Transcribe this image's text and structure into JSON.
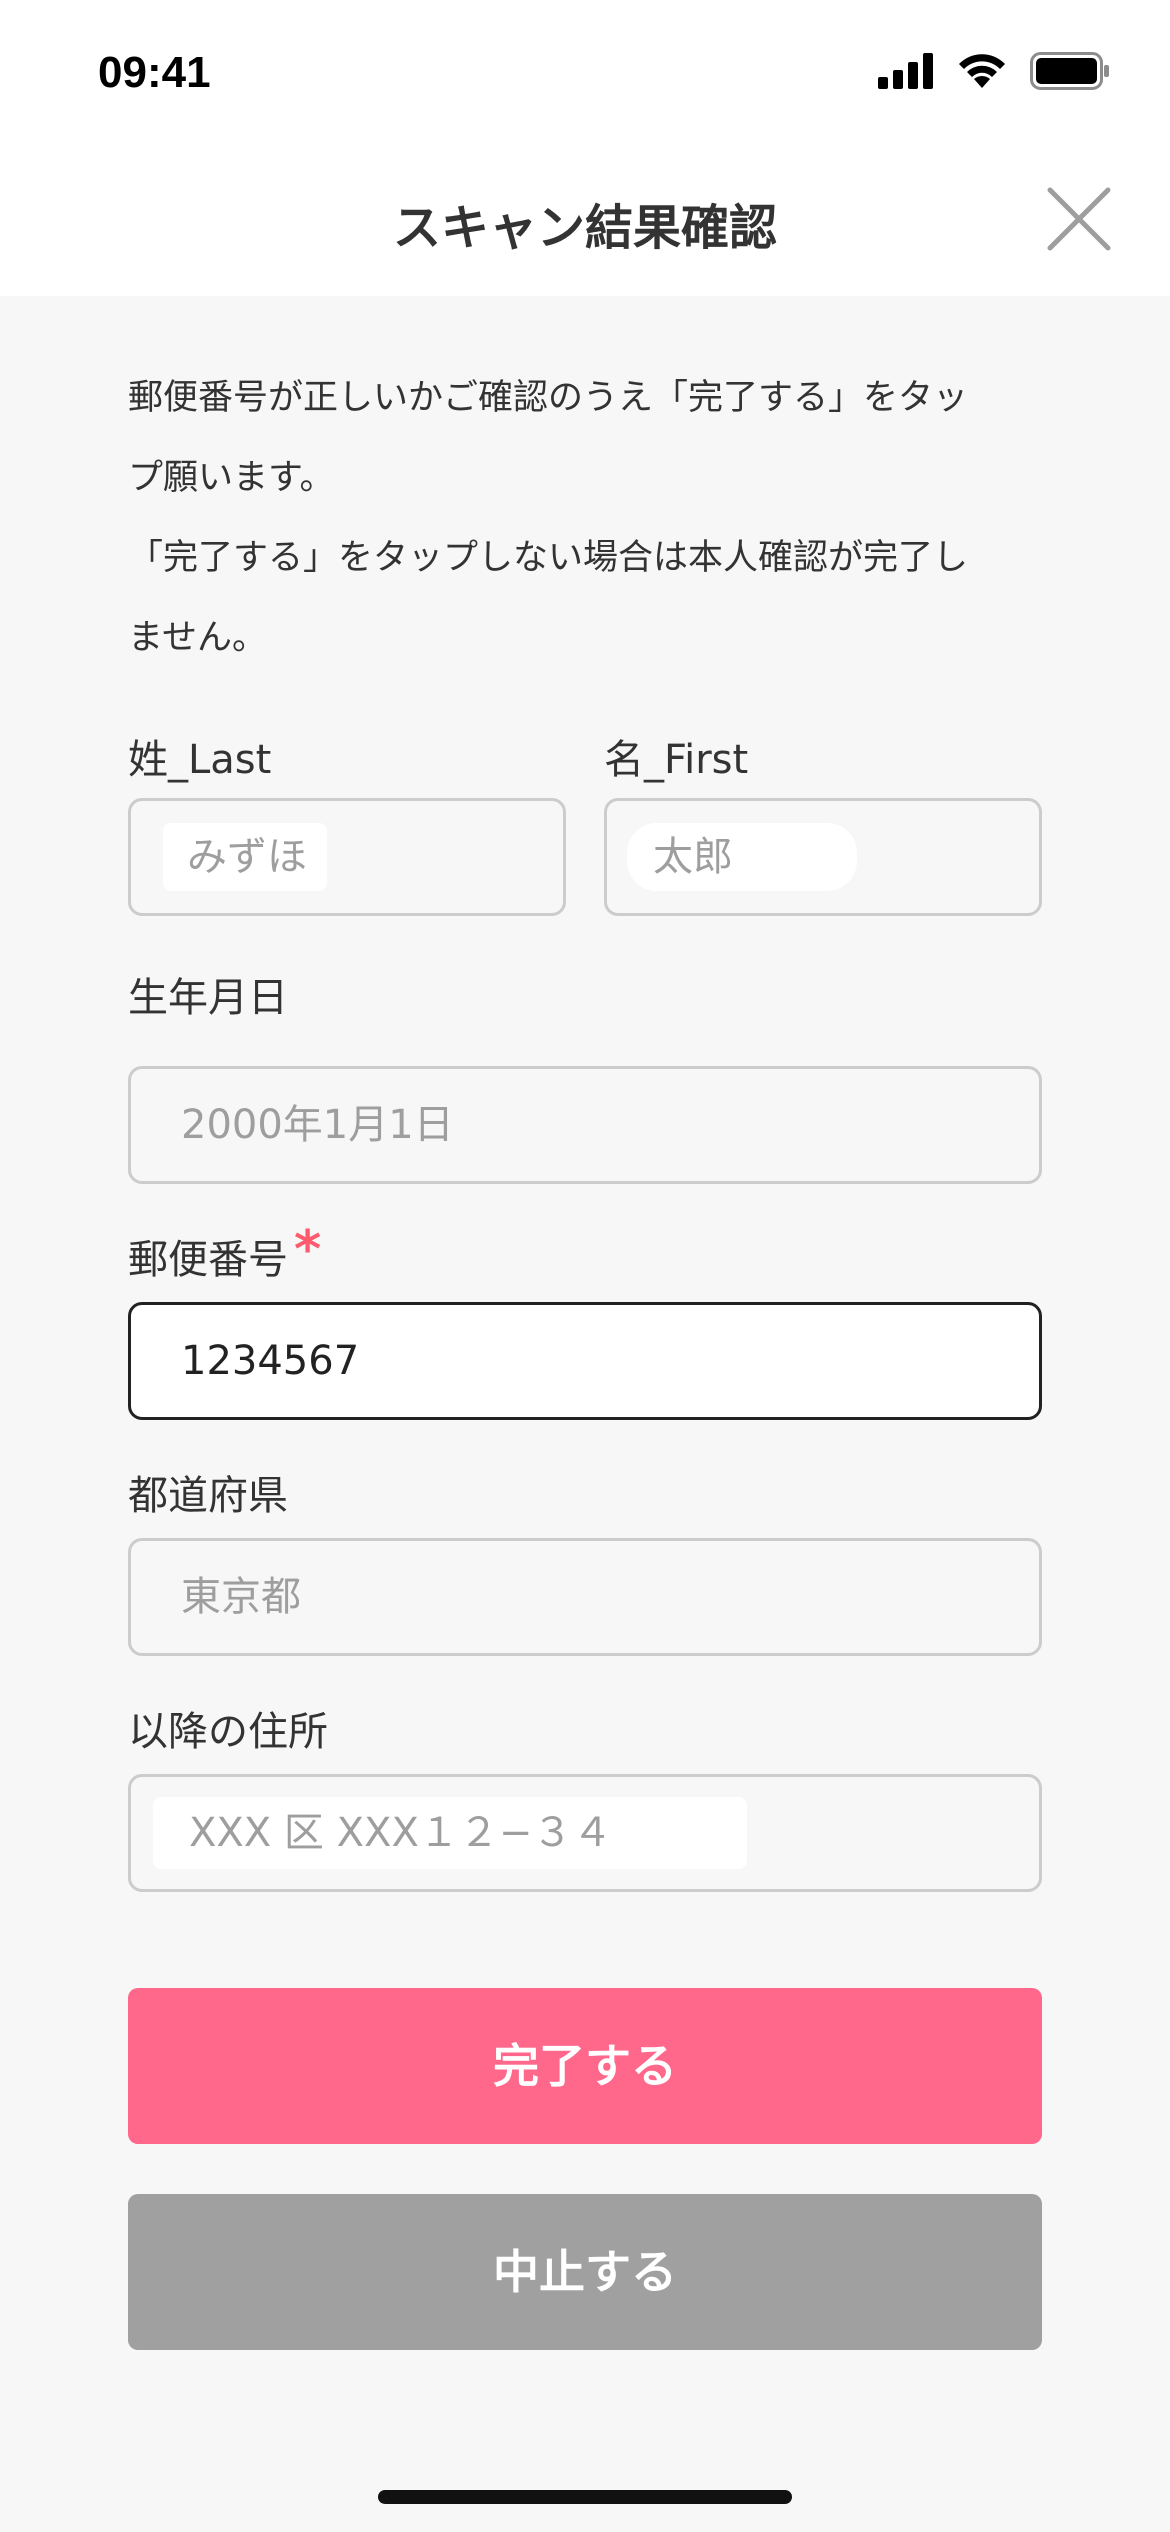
{
  "status_bar": {
    "time": "09:41"
  },
  "header": {
    "title": "スキャン結果確認"
  },
  "intro": {
    "line1": "郵便番号が正しいかご確認のうえ「完了する」をタッ",
    "line2": "プ願います。",
    "line3": "「完了する」をタップしない場合は本人確認が完了し",
    "line4": "ません。"
  },
  "form": {
    "last_name": {
      "label": "姓_Last",
      "value": "みずほ"
    },
    "first_name": {
      "label": "名_First",
      "value": "太郎"
    },
    "birthdate": {
      "label": "生年月日",
      "value": "2000年1月1日"
    },
    "postal_code": {
      "label": "郵便番号",
      "required_mark": "*",
      "value": "1234567"
    },
    "prefecture": {
      "label": "都道府県",
      "value": "東京都"
    },
    "address": {
      "label": "以降の住所",
      "value": "XXX 区 XXX１２−３４"
    }
  },
  "buttons": {
    "done": "完了する",
    "cancel": "中止する"
  },
  "colors": {
    "accent": "#ff678b",
    "required": "#ff5a6e",
    "cancel": "#a0a0a0"
  }
}
